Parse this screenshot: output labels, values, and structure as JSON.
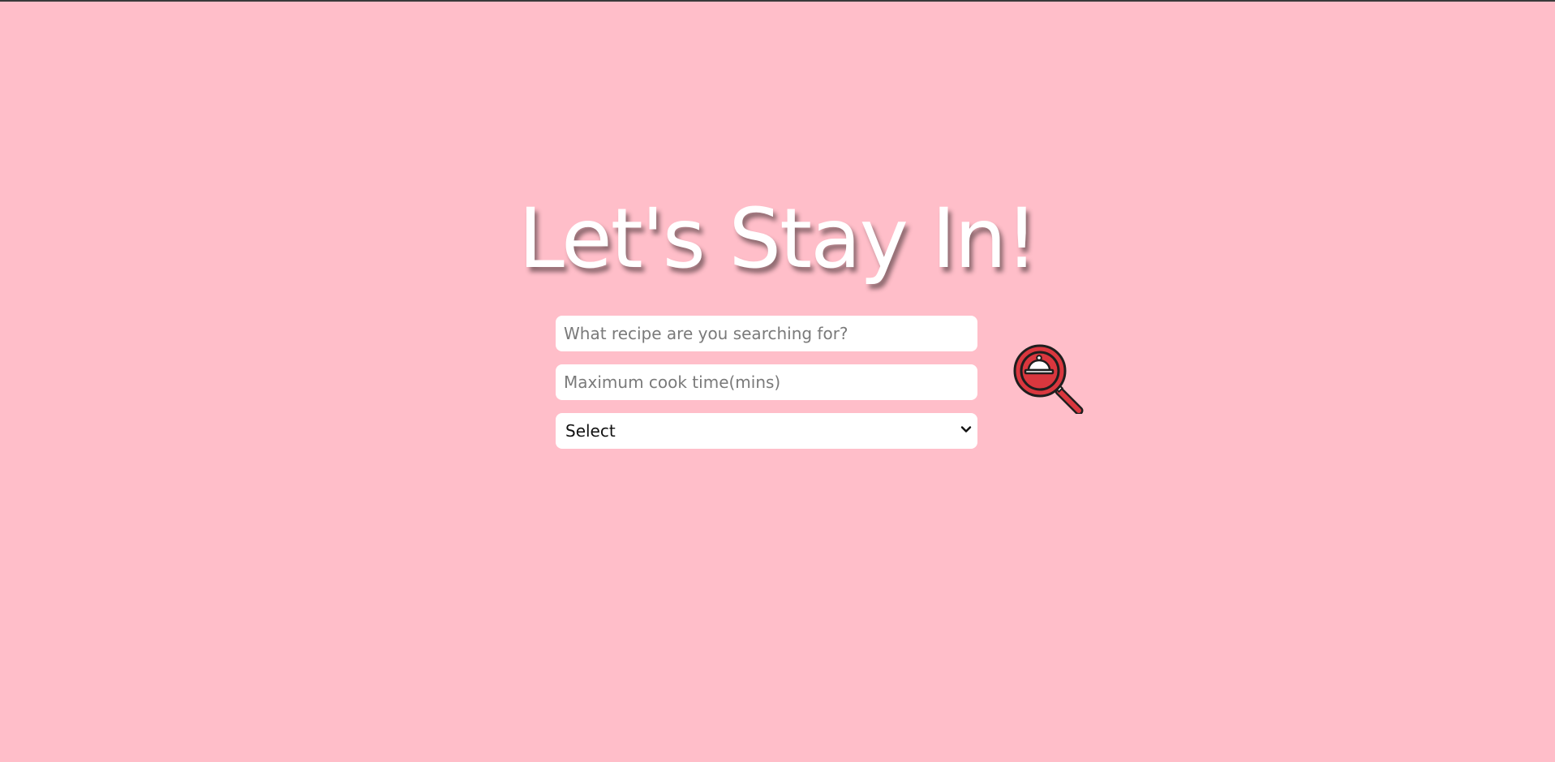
{
  "page": {
    "title": "Let's Stay In!"
  },
  "search": {
    "recipe_placeholder": "What recipe are you searching for?",
    "cook_time_placeholder": "Maximum cook time(mins)",
    "select_value": "Select",
    "button_icon": "cloche-magnifier-icon"
  },
  "colors": {
    "background": "#ffbec9",
    "title": "#ffffff",
    "icon_red": "#d9373e",
    "icon_outline": "#1e1e1e"
  }
}
